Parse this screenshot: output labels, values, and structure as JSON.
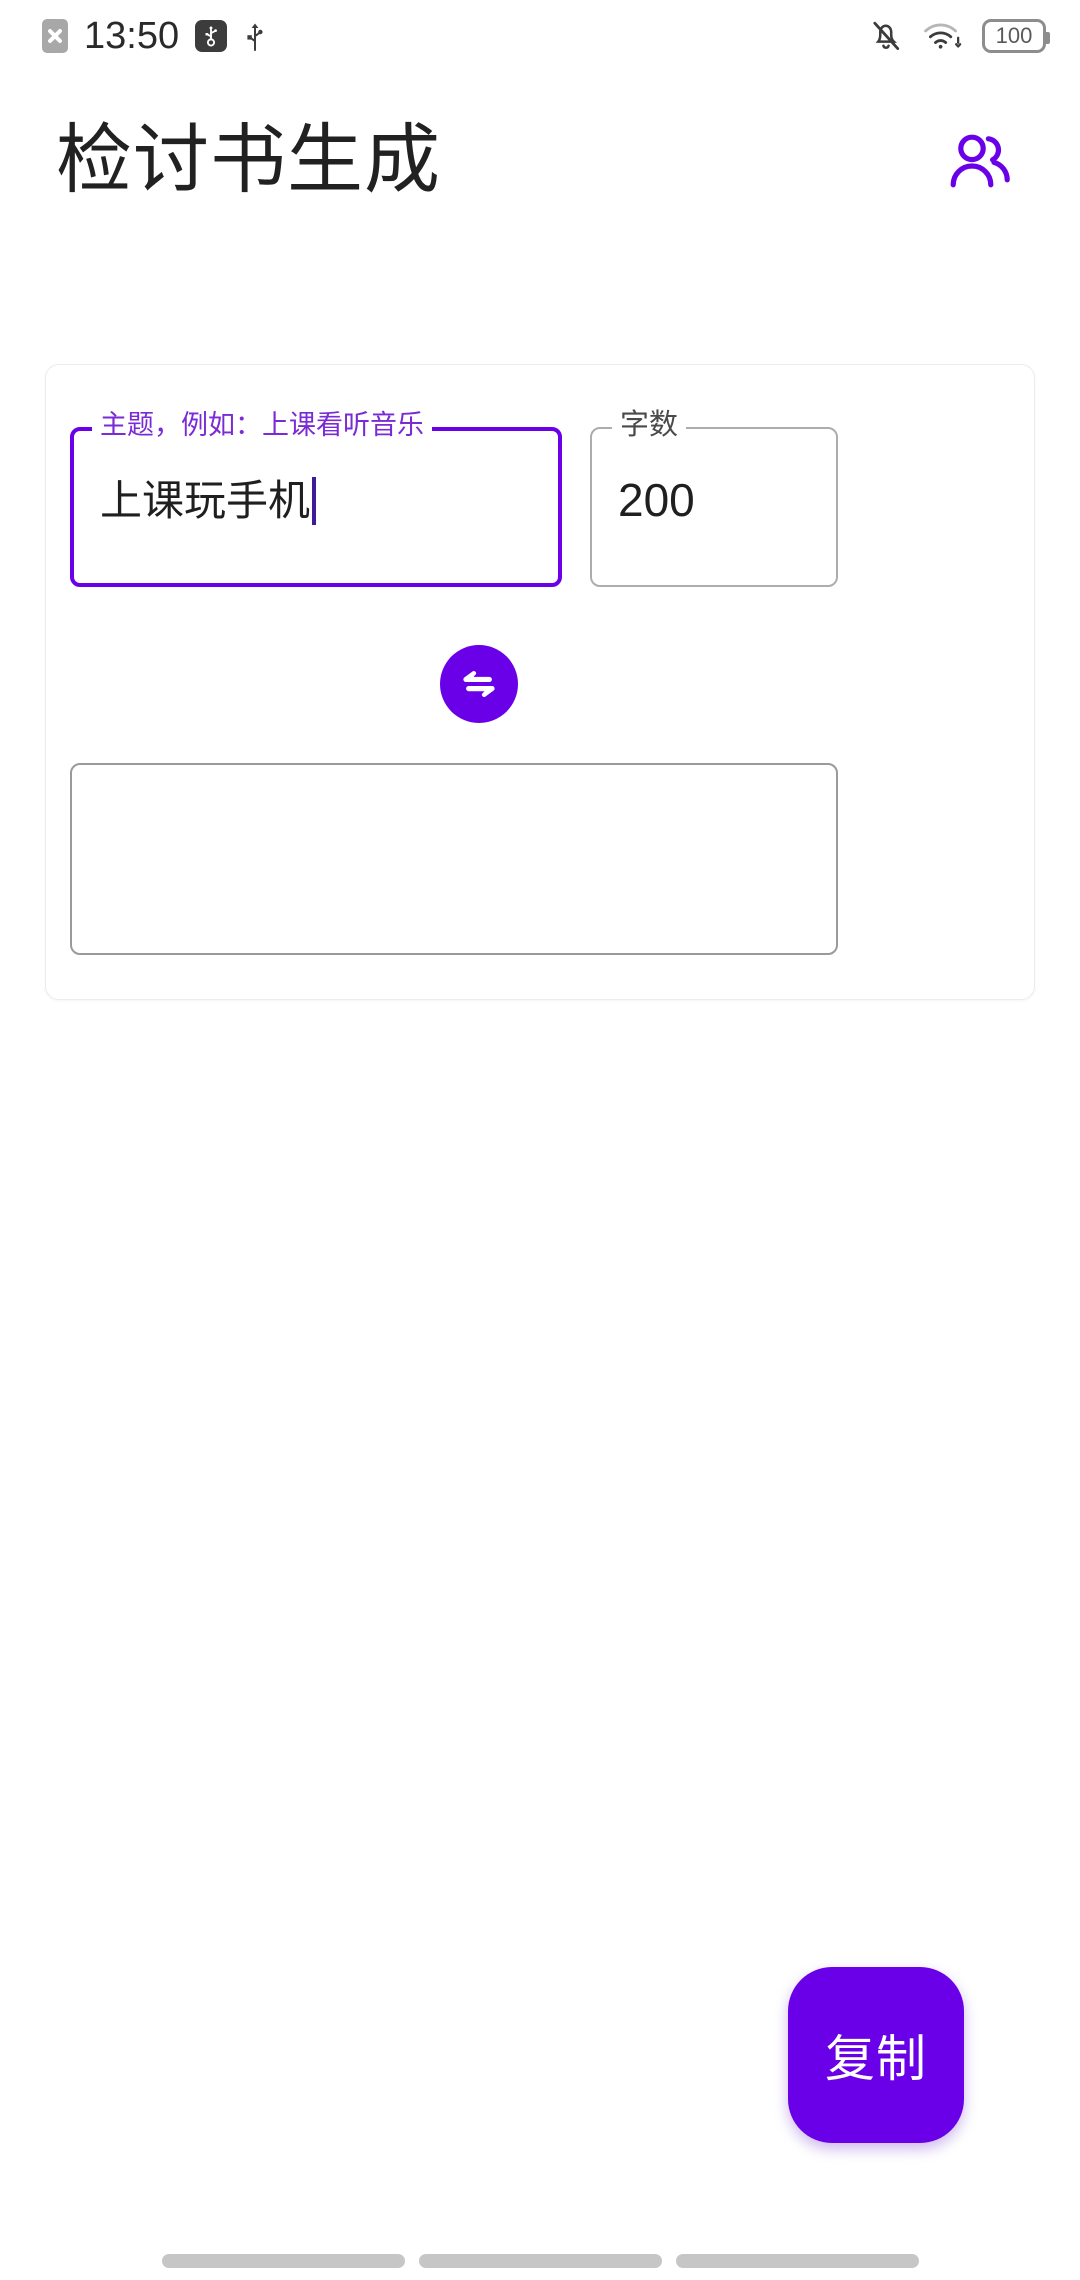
{
  "status_bar": {
    "time": "13:50",
    "battery_level": "100",
    "left_icons": [
      "sim-missing-icon",
      "usb-debug-icon",
      "usb-icon"
    ],
    "right_icons": [
      "notifications-off-icon",
      "wifi-icon",
      "battery-icon"
    ]
  },
  "header": {
    "title": "检讨书生成",
    "people_icon": "people-icon"
  },
  "card": {
    "topic_input": {
      "label": "主题，例如：上课看听音乐",
      "value": "上课玩手机",
      "focused": true
    },
    "count_input": {
      "label": "字数",
      "value": "200",
      "focused": false
    },
    "generate_button": {
      "icon": "swap-horizontal-icon",
      "label": ""
    },
    "output_area": {
      "value": "",
      "placeholder": ""
    }
  },
  "copy_button": {
    "label": "复制"
  },
  "nav_bar": {
    "items": [
      "nav-recents-pill",
      "nav-home-pill",
      "nav-back-pill"
    ]
  },
  "colors": {
    "accent_purple": "#6a00e8",
    "label_purple": "#7a2bd6",
    "border_gray": "#9a9a9a",
    "card_border": "#ececec",
    "text_primary": "#1f1f1f",
    "nav_pill_gray": "#c6c6c6",
    "background": "#ffffff"
  }
}
